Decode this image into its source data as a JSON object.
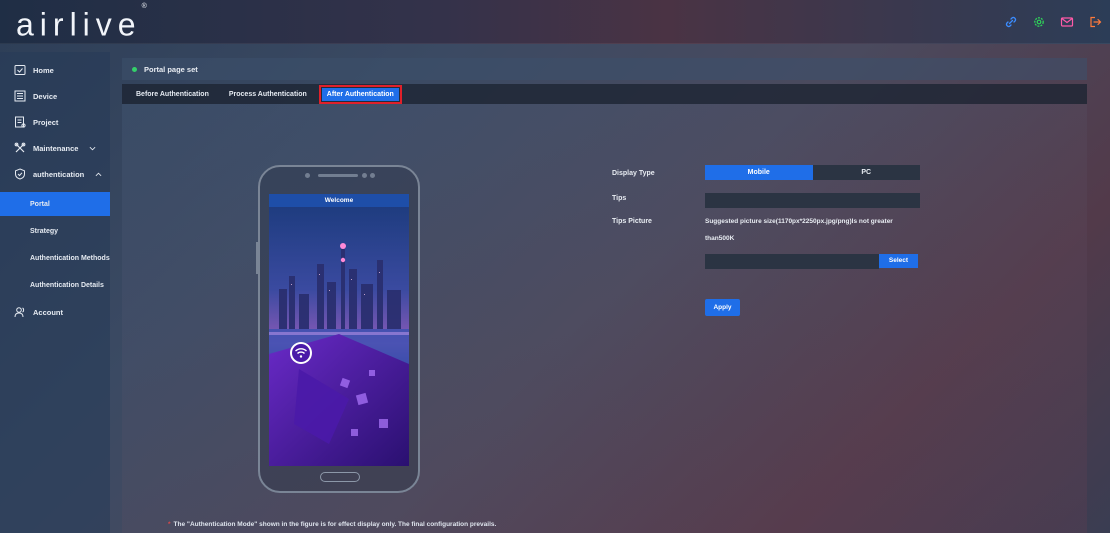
{
  "brand": {
    "logo_text": "airlive",
    "logo_mark": "®"
  },
  "topbar": {
    "icons": [
      "link-icon",
      "settings-gear-icon",
      "mail-icon",
      "logout-icon"
    ]
  },
  "sidebar": {
    "items": [
      {
        "label": "Home",
        "icon": "home-icon"
      },
      {
        "label": "Device",
        "icon": "device-list-icon"
      },
      {
        "label": "Project",
        "icon": "project-icon"
      },
      {
        "label": "Maintenance",
        "icon": "maintenance-tools-icon"
      },
      {
        "label": "authentication",
        "icon": "shield-check-icon"
      },
      {
        "label": "Portal"
      },
      {
        "label": "Strategy"
      },
      {
        "label": "Authentication Methods"
      },
      {
        "label": "Authentication Details"
      },
      {
        "label": "Account",
        "icon": "account-users-icon"
      }
    ]
  },
  "panel": {
    "title": "Portal page set"
  },
  "tabs": [
    "Before Authentication",
    "Process Authentication",
    "After Authentication"
  ],
  "phone": {
    "screen_title": "Welcome"
  },
  "form": {
    "display_type_label": "Display Type",
    "display_type_options": [
      "Mobile",
      "PC"
    ],
    "display_type_selected": "Mobile",
    "tips_label": "Tips",
    "tips_value": "",
    "tips_picture_label": "Tips Picture",
    "tips_picture_hint_line1": "Suggested picture size(1170px*2250px.jpg/png)Is not greater",
    "tips_picture_hint_line2": "than500K",
    "picture_value": "",
    "select_label": "Select",
    "apply_label": "Apply"
  },
  "footnote": {
    "marker": "*",
    "text": "The \"Authentication Mode\" shown in the figure is for effect display only. The final configuration prevails."
  },
  "colors": {
    "accent": "#1f6ee8",
    "status_dot": "#34d06a",
    "highlight_border": "#e0202a",
    "icon_blue": "#3b8cff",
    "icon_green": "#2fd05a",
    "icon_pink": "#ff5aa8",
    "icon_orange": "#ff7a3a"
  }
}
